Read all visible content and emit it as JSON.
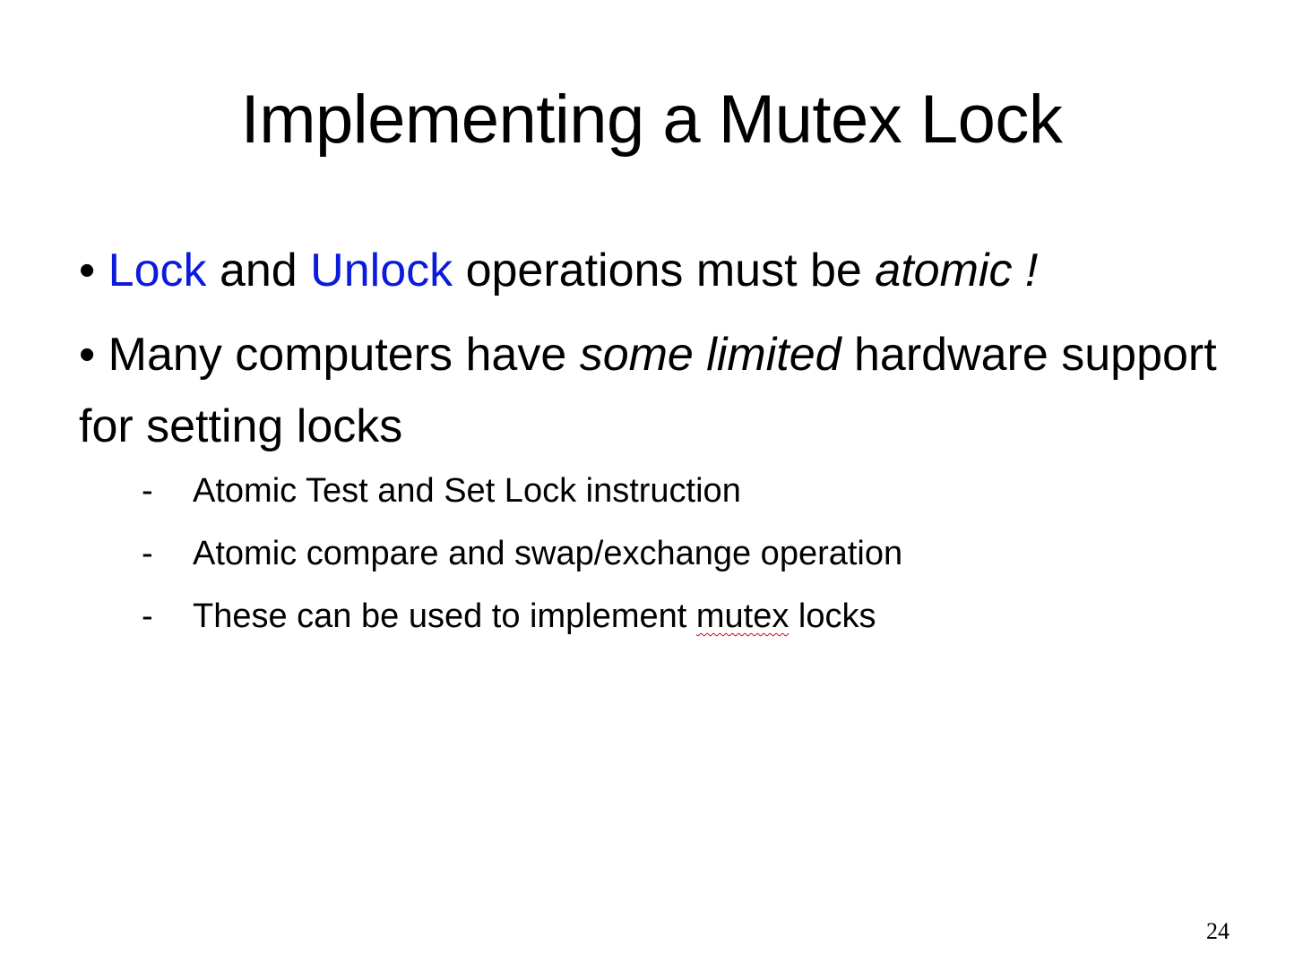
{
  "slide": {
    "title": "Implementing a Mutex Lock",
    "bullet_marker": "•",
    "bullet1": {
      "part1": "Lock",
      "part2": " and ",
      "part3": "Unlock",
      "part4": " operations must be ",
      "part5": "atomic !"
    },
    "bullet2": {
      "part1": " Many computers have ",
      "part2": "some limited",
      "part3": " hardware support for setting locks"
    },
    "subitems": [
      {
        "dash": "-",
        "text": "Atomic Test and Set Lock instruction"
      },
      {
        "dash": "-",
        "text": "Atomic compare and swap/exchange operation"
      },
      {
        "dash": "-",
        "text_before": "These can be used to implement ",
        "text_flagged": "mutex",
        "text_after": " locks"
      }
    ],
    "page_number": "24"
  },
  "colors": {
    "accent": "#0a1bdc",
    "text": "#000000",
    "background": "#ffffff",
    "spellcheck_underline": "#d0021b"
  }
}
